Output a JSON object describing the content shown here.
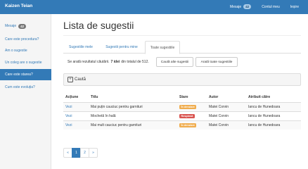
{
  "navbar": {
    "brand": "Kaizen Teian",
    "messages_label": "Mesaje",
    "messages_count": "42",
    "account_label": "Contul meu",
    "logout_label": "Ieșire"
  },
  "sidebar": {
    "items": [
      {
        "label": "Mesaje",
        "badge": "42"
      },
      {
        "label": "Care este procedura?"
      },
      {
        "label": "Am o sugestie"
      },
      {
        "label": "Un coleg are o sugestie"
      },
      {
        "label": "Care este starea?"
      },
      {
        "label": "Cum este evoluția?"
      }
    ],
    "active_index": 4
  },
  "page": {
    "title": "Lista de sugestii"
  },
  "tabs": [
    {
      "label": "Sugestiile mele"
    },
    {
      "label": "Sugestii pentru mine"
    },
    {
      "label": "Toate sugestiile"
    }
  ],
  "results": {
    "prefix": "Se arată rezultatul căutării.",
    "count": "7 idei",
    "suffix": "din totalul de 512.",
    "search_other_button": "Caută alte sugestii",
    "show_all_button": "Arată toate sugestiile"
  },
  "search": {
    "icon_glyph": "+",
    "label": "Caută"
  },
  "table": {
    "headers": [
      "Acțiune",
      "Titlu",
      "Stare",
      "Autor",
      "Atribuit către"
    ],
    "rows": [
      {
        "action": "Vezi",
        "title": "Mai puțin cauciuc pentru garnituri",
        "status": "În derulare",
        "status_color": "#f0ad4e",
        "author": "Matei Corvin",
        "assignee": "Iancu de Hunedoara"
      },
      {
        "action": "Vezi",
        "title": "Mochetă în hală",
        "status": "Respinsă",
        "status_color": "#d9534f",
        "author": "Matei Corvin",
        "assignee": "Iancu de Hunedoara"
      },
      {
        "action": "Vezi",
        "title": "Mai mult cauciuc pentru garnituri",
        "status": "În derulare",
        "status_color": "#f0ad4e",
        "author": "Matei Corvin",
        "assignee": "Iancu de Hunedoara"
      }
    ]
  },
  "pagination": {
    "prev": "«",
    "pages": [
      "1",
      "2"
    ],
    "next": "»",
    "active_page": "1"
  }
}
